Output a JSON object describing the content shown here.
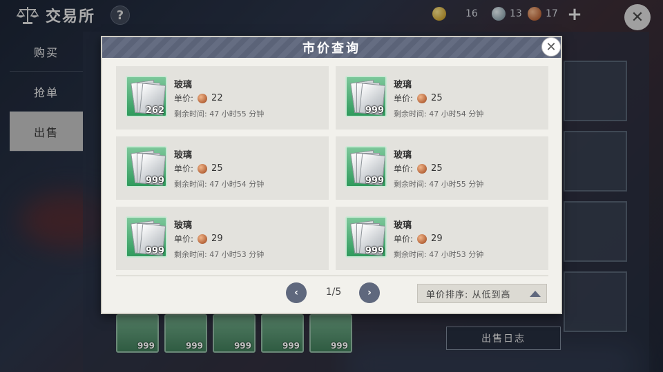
{
  "header": {
    "title": "交易所",
    "help_label": "?",
    "currency": [
      {
        "type": "gold",
        "value": "16"
      },
      {
        "type": "silver",
        "value": "13"
      },
      {
        "type": "copper",
        "value": "17"
      }
    ],
    "plus_label": "+",
    "close_label": "✕"
  },
  "sidebar": {
    "items": [
      {
        "label": "购买",
        "active": false
      },
      {
        "label": "抢单",
        "active": false
      },
      {
        "label": "出售",
        "active": true
      }
    ]
  },
  "background": {
    "inventory_quantities": [
      "999",
      "999",
      "999",
      "999",
      "999"
    ],
    "sale_log_label": "出售日志"
  },
  "modal": {
    "title": "市价查询",
    "close_label": "✕",
    "price_label": "单价:",
    "listings": [
      {
        "name": "玻璃",
        "quantity": "262",
        "price": "22",
        "remaining": "剩余时间: 47 小时55 分钟"
      },
      {
        "name": "玻璃",
        "quantity": "999",
        "price": "25",
        "remaining": "剩余时间: 47 小时54 分钟"
      },
      {
        "name": "玻璃",
        "quantity": "999",
        "price": "25",
        "remaining": "剩余时间: 47 小时54 分钟"
      },
      {
        "name": "玻璃",
        "quantity": "999",
        "price": "25",
        "remaining": "剩余时间: 47 小时55 分钟"
      },
      {
        "name": "玻璃",
        "quantity": "999",
        "price": "29",
        "remaining": "剩余时间: 47 小时53 分钟"
      },
      {
        "name": "玻璃",
        "quantity": "999",
        "price": "29",
        "remaining": "剩余时间: 47 小时53 分钟"
      }
    ],
    "pagination": {
      "current": "1/5",
      "prev": "‹",
      "next": "›"
    },
    "sort_label": "单价排序: 从低到高"
  },
  "colors": {
    "header_bar": "#5b6378",
    "item_green": "#2f9a5c",
    "copper_coin": "#b6653a"
  }
}
